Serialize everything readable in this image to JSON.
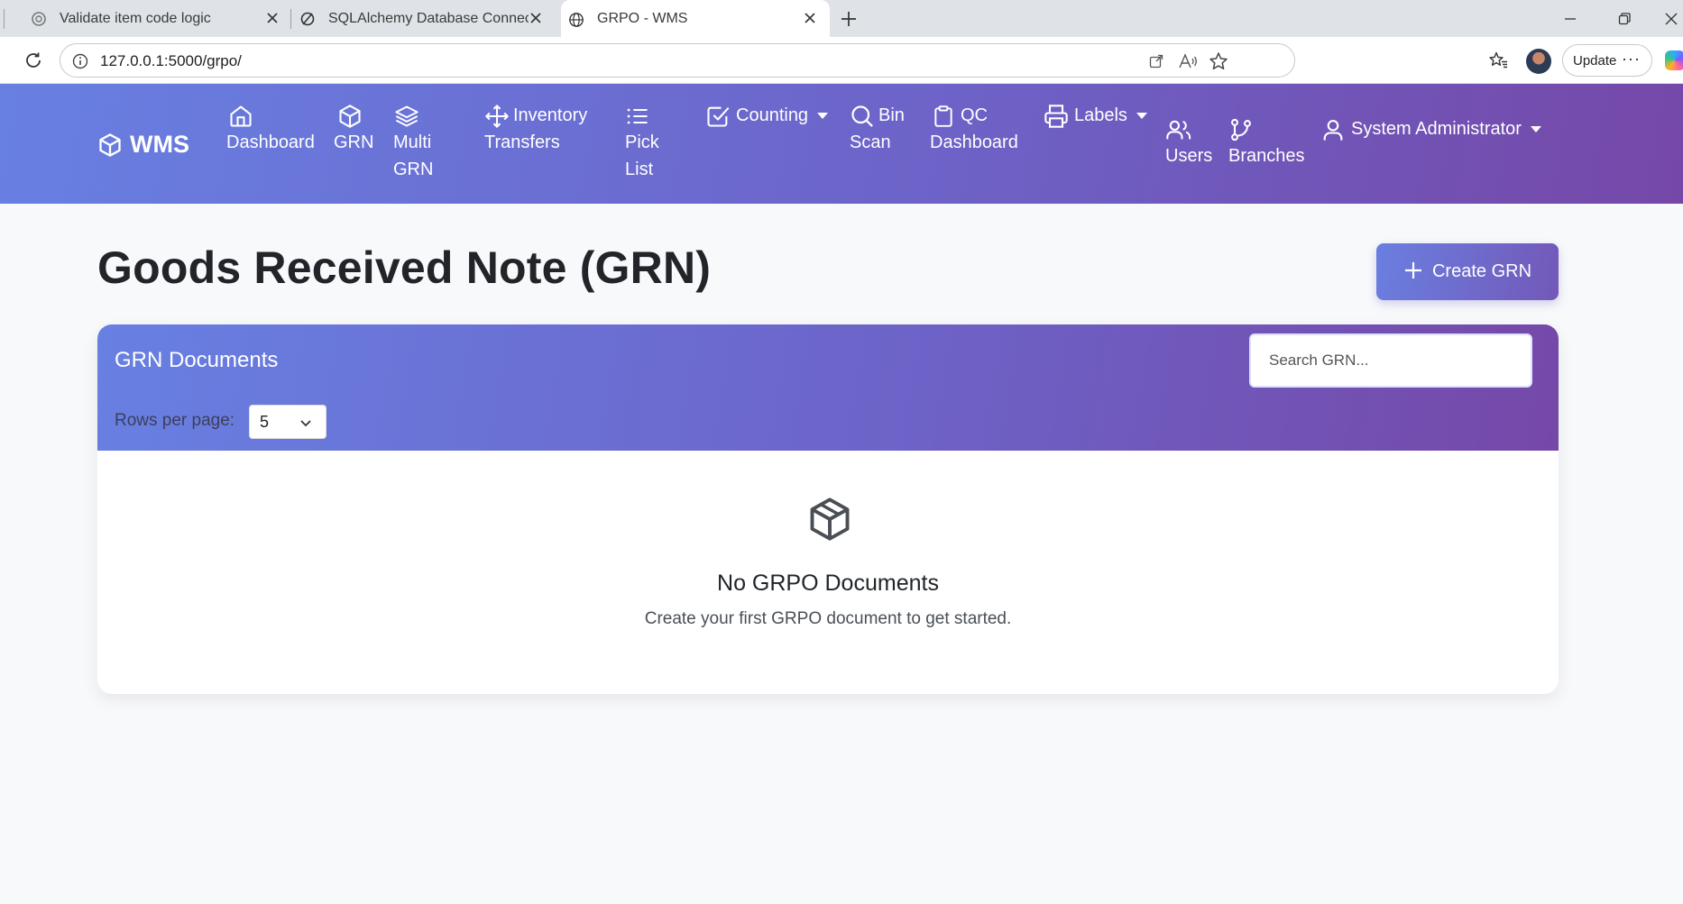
{
  "browser": {
    "tabs": [
      {
        "title": "Validate item code logic",
        "active": false
      },
      {
        "title": "SQLAlchemy Database Connectio",
        "active": false
      },
      {
        "title": "GRPO - WMS",
        "active": true
      }
    ],
    "url": "127.0.0.1:5000/grpo/",
    "update_label": "Update",
    "more_label": "···"
  },
  "navbar": {
    "brand": "WMS",
    "items": [
      {
        "lines": [
          "Dashboard"
        ],
        "icon": "home-icon"
      },
      {
        "lines": [
          "GRN"
        ],
        "icon": "box-icon"
      },
      {
        "lines": [
          "Multi",
          "GRN"
        ],
        "icon": "layers-icon"
      },
      {
        "lines": [
          "Inventory",
          "Transfers"
        ],
        "icon": "move-icon"
      },
      {
        "lines": [
          "Pick",
          "List"
        ],
        "icon": "list-icon"
      },
      {
        "lines": [
          "Counting"
        ],
        "icon": "check-square-icon",
        "dropdown": true
      },
      {
        "lines": [
          "Bin",
          "Scan"
        ],
        "icon": "search-icon"
      },
      {
        "lines": [
          "QC",
          "Dashboard"
        ],
        "icon": "clipboard-icon"
      },
      {
        "lines": [
          "Labels"
        ],
        "icon": "printer-icon",
        "dropdown": true
      },
      {
        "lines": [
          "Users"
        ],
        "icon": "users-icon"
      },
      {
        "lines": [
          "Branches"
        ],
        "icon": "git-branch-icon"
      },
      {
        "lines": [
          "System Administrator"
        ],
        "icon": "user-icon",
        "dropdown": true
      }
    ]
  },
  "page": {
    "title": "Goods Received Note (GRN)",
    "create_button": "Create GRN"
  },
  "card": {
    "title": "GRN Documents",
    "search_placeholder": "Search GRN...",
    "rows_label": "Rows per page:",
    "rows_value": "5",
    "empty_title": "No GRPO Documents",
    "empty_subtitle": "Create your first GRPO document to get started."
  },
  "colors": {
    "gradient_start": "#6880e2",
    "gradient_end": "#7548a8",
    "page_bg": "#f8f9fb"
  }
}
